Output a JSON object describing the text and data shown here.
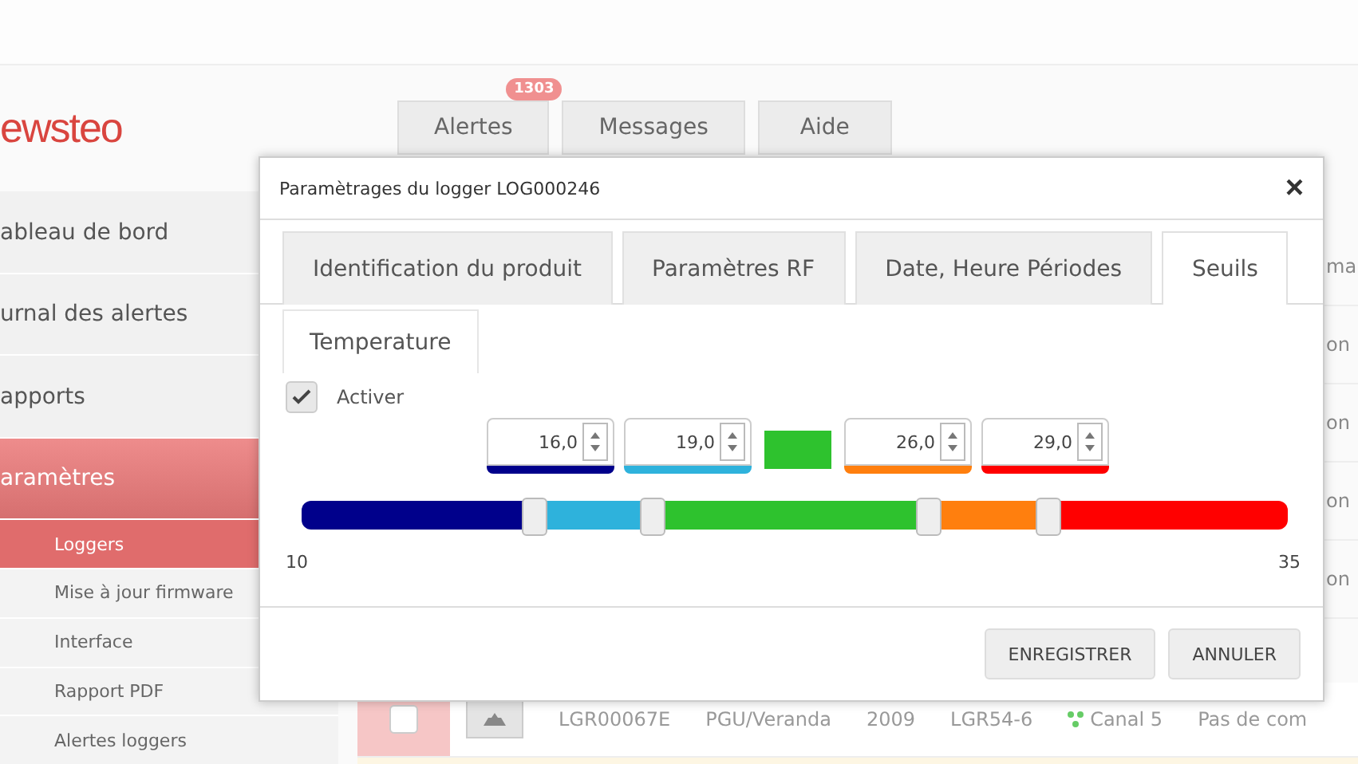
{
  "sidebar": {
    "logo": "ewsteo",
    "items": [
      {
        "label": "ableau de bord",
        "selected": false
      },
      {
        "label": "urnal des alertes",
        "selected": false
      },
      {
        "label": "apports",
        "selected": false
      },
      {
        "label": "aramètres",
        "selected": true
      }
    ],
    "sub_items": [
      {
        "label": "Loggers",
        "selected": true
      },
      {
        "label": "Mise à jour firmware",
        "selected": false
      },
      {
        "label": "Interface",
        "selected": false
      },
      {
        "label": "Rapport PDF",
        "selected": false
      },
      {
        "label": "Alertes loggers",
        "selected": false
      }
    ]
  },
  "top_buttons": [
    {
      "label": "Alertes",
      "badge": "1303"
    },
    {
      "label": "Messages"
    },
    {
      "label": "Aide"
    }
  ],
  "table": {
    "column_fragments": [
      "ma",
      "on",
      "on",
      "on",
      "on"
    ],
    "last_row": {
      "checked": false,
      "cells": [
        "LGR00067E",
        "PGU/Veranda",
        "2009",
        "LGR54-6",
        "Canal 5",
        "Pas de com"
      ]
    }
  },
  "dialog": {
    "title": "Paramètrages du logger LOG000246",
    "close": "×",
    "tabs": [
      {
        "label": "Identification du produit",
        "selected": false
      },
      {
        "label": "Paramètres RF",
        "selected": false
      },
      {
        "label": "Date, Heure Périodes",
        "selected": false
      },
      {
        "label": "Seuils",
        "selected": true
      }
    ],
    "subtabs": [
      {
        "label": "Temperature",
        "selected": true
      }
    ],
    "activate": {
      "label": "Activer",
      "checked": true
    },
    "thresholds": [
      {
        "value": "16,0",
        "color": "#00008b",
        "level": 0.235
      },
      {
        "value": "19,0",
        "color": "#2eb2dc",
        "level": 0.355
      },
      {
        "value": "26,0",
        "color": "#ff7f0e",
        "level": 0.635
      },
      {
        "value": "29,0",
        "color": "#ff0000",
        "level": 0.756
      }
    ],
    "ok_zone": {
      "color": "#2ec22e"
    },
    "scale": {
      "min": "10",
      "max": "35"
    },
    "buttons": [
      "ENREGISTRER",
      "ANNULER"
    ]
  }
}
